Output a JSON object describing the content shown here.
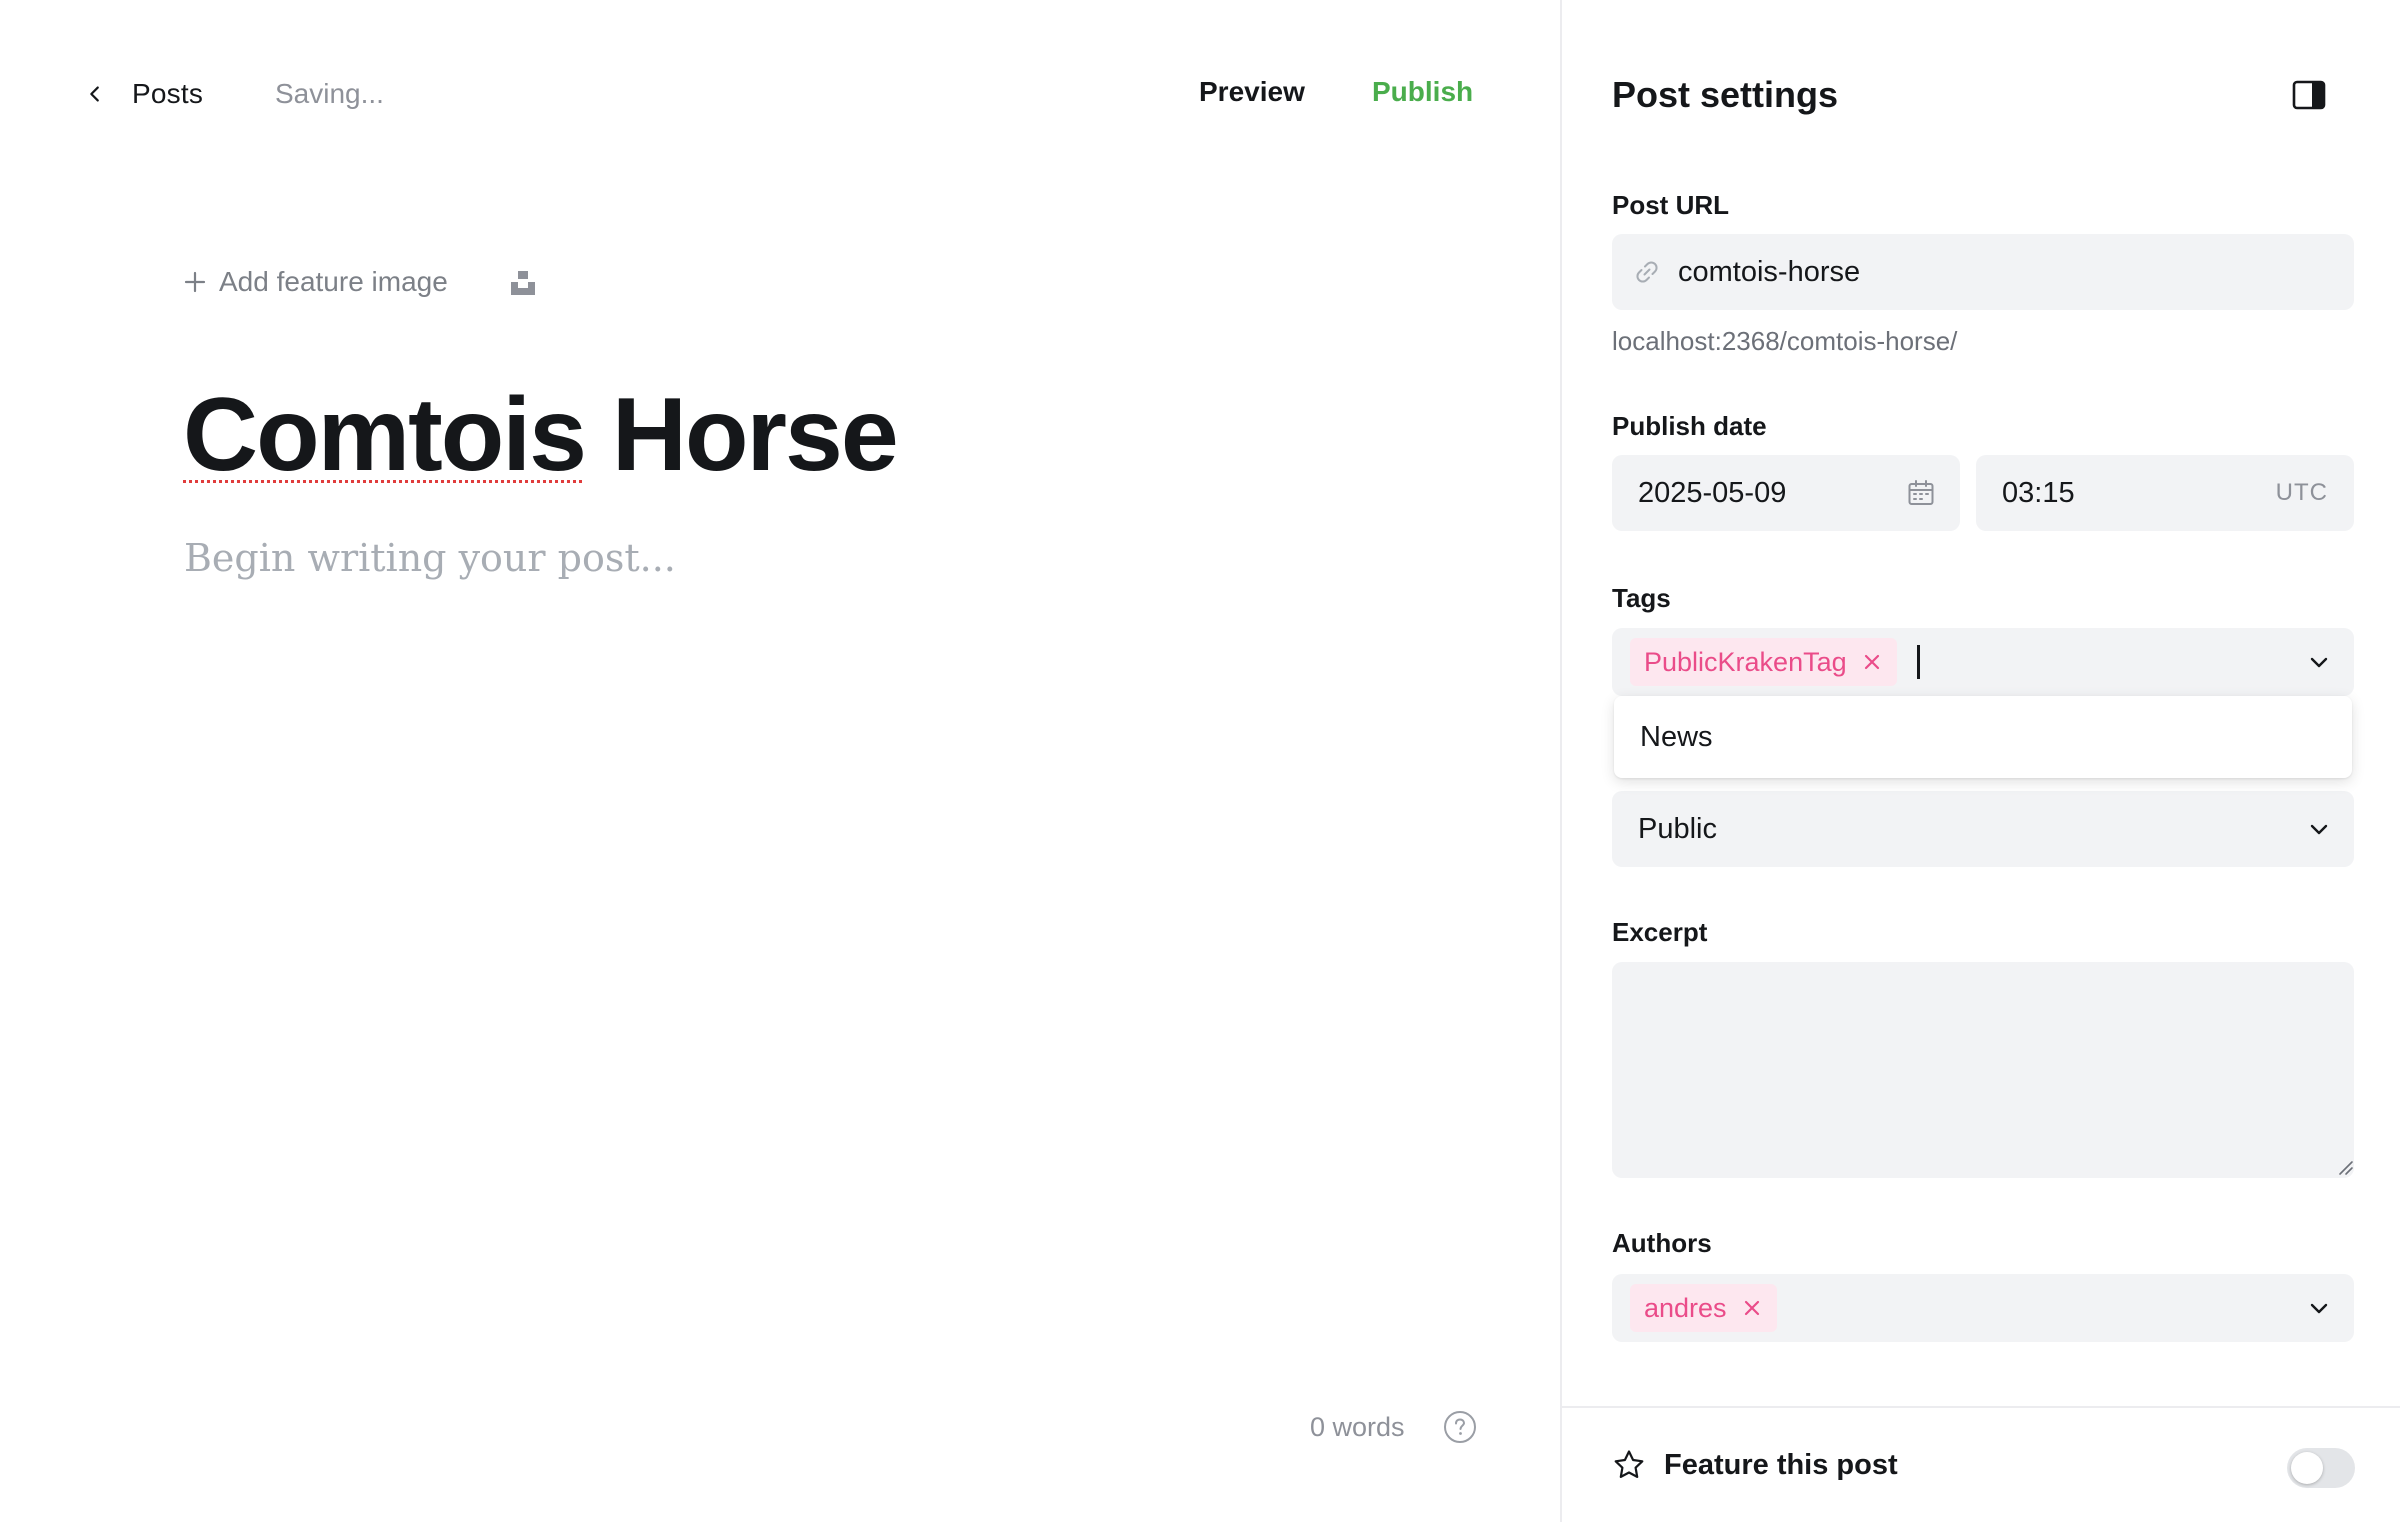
{
  "header": {
    "back_label": "Posts",
    "status": "Saving...",
    "preview_label": "Preview",
    "publish_label": "Publish"
  },
  "editor": {
    "add_feature_image_label": "Add feature image",
    "title_word_1": "Comtois",
    "title_word_2": " Horse",
    "body_placeholder": "Begin writing your post...",
    "word_count": "0 words"
  },
  "settings": {
    "title": "Post settings",
    "post_url": {
      "label": "Post URL",
      "value": "comtois-horse",
      "hint": "localhost:2368/comtois-horse/"
    },
    "publish_date": {
      "label": "Publish date",
      "date": "2025-05-09",
      "time": "03:15",
      "timezone": "UTC"
    },
    "tags": {
      "label": "Tags",
      "selected": [
        "PublicKrakenTag"
      ],
      "dropdown_options": [
        "News"
      ]
    },
    "access": {
      "value": "Public"
    },
    "excerpt": {
      "label": "Excerpt",
      "value": ""
    },
    "authors": {
      "label": "Authors",
      "selected": [
        "andres"
      ]
    },
    "feature_post": {
      "label": "Feature this post",
      "enabled": false
    }
  },
  "colors": {
    "publish_green": "#4aad4c",
    "tag_pink": "#ea4c89",
    "tag_bg": "#fde7ef",
    "input_bg": "#f2f3f5"
  },
  "icons": [
    "chevron-left-icon",
    "plus-icon",
    "unsplash-icon",
    "help-icon",
    "panel-icon",
    "link-icon",
    "calendar-icon",
    "close-icon",
    "chevron-down-icon",
    "star-icon"
  ]
}
